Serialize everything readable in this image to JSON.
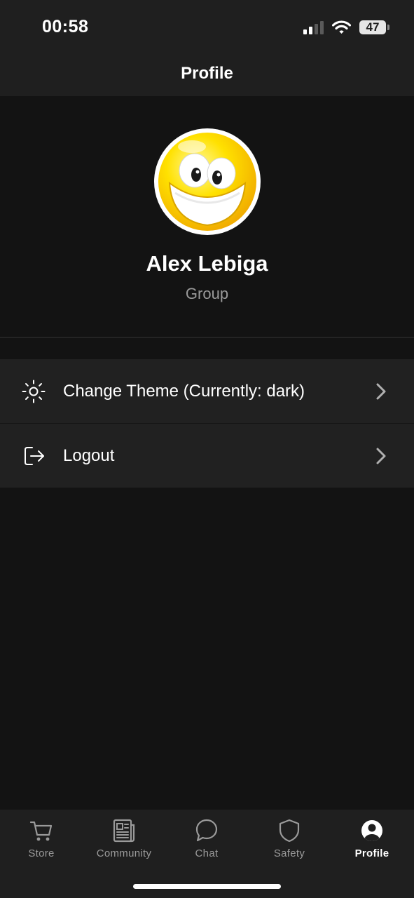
{
  "status_bar": {
    "time": "00:58",
    "battery": "47",
    "icons": [
      "cellular-signal-icon",
      "wifi-icon",
      "battery-icon"
    ]
  },
  "header": {
    "title": "Profile"
  },
  "profile": {
    "avatar_icon": "smiley-face-avatar",
    "name": "Alex Lebiga",
    "subtitle": "Group"
  },
  "menu": {
    "items": [
      {
        "label": "Change Theme (Currently: dark)",
        "icon": "sun-icon"
      },
      {
        "label": "Logout",
        "icon": "logout-icon"
      }
    ]
  },
  "bottom_nav": {
    "items": [
      {
        "label": "Store",
        "icon": "cart-icon",
        "active": false
      },
      {
        "label": "Community",
        "icon": "newspaper-icon",
        "active": false
      },
      {
        "label": "Chat",
        "icon": "chat-bubble-icon",
        "active": false
      },
      {
        "label": "Safety",
        "icon": "shield-icon",
        "active": false
      },
      {
        "label": "Profile",
        "icon": "user-circle-icon",
        "active": true
      }
    ]
  },
  "colors": {
    "background": "#131313",
    "surface": "#1f1f1f",
    "menu_item": "#212121",
    "text_primary": "#ffffff",
    "text_secondary": "#9a9a9a"
  }
}
